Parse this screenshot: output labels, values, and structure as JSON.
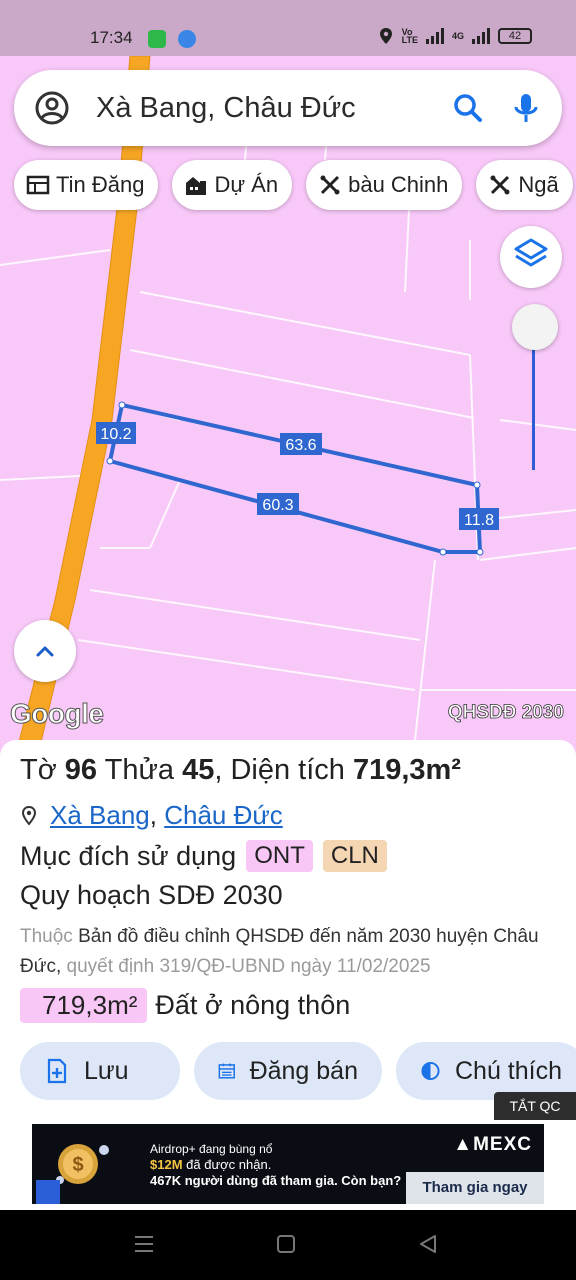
{
  "status_bar": {
    "time": "17:34",
    "network_label": "4G",
    "battery_level": "42"
  },
  "search": {
    "query": "Xà Bang, Châu Đức"
  },
  "chips": [
    {
      "label": "Tin Đăng",
      "icon": "listing-icon"
    },
    {
      "label": "Dự Án",
      "icon": "building-icon"
    },
    {
      "label": "bàu Chinh",
      "icon": "tools-icon"
    },
    {
      "label": "Ngã",
      "icon": "tools-icon"
    }
  ],
  "map": {
    "edge_labels": [
      "10.2",
      "63.6",
      "60.3",
      "11.8"
    ],
    "logo": "Google",
    "layer_label": "QHSDĐ 2030",
    "colors": {
      "land": "#f8c8f8",
      "road": "#f6a623",
      "parcel": "#2f66cf"
    }
  },
  "parcel": {
    "title_prefix": "Tờ",
    "sheet_no": "96",
    "title_mid": "Thửa",
    "parcel_no": "45",
    "title_area_label": ", Diện tích",
    "area": "719,3m²",
    "location_ward": "Xà Bang",
    "location_district": "Châu Đức",
    "purpose_label": "Mục đích sử dụng",
    "purpose_codes": [
      "ONT",
      "CLN"
    ],
    "plan_title": "Quy hoạch SDĐ 2030",
    "plan_source_prefix": "Thuộc",
    "plan_source": "Bản đồ điều chỉnh QHSDĐ đến năm 2030 huyện Châu Đức,",
    "plan_decision": "quyết định 319/QĐ-UBND ngày 11/02/2025",
    "land_area": "719,3m²",
    "land_type": "Đất ở nông thôn"
  },
  "actions": {
    "save": "Lưu",
    "post": "Đăng bán",
    "legend": "Chú thích"
  },
  "ad": {
    "close_label": "TẮT QC",
    "line1": "Airdrop+ đang bùng nổ",
    "line2_amount": "$12M",
    "line2_rest": " đã được nhận.",
    "line3": "467K người dùng đã tham gia. Còn bạn?",
    "brand": "MEXC",
    "cta": "Tham gia ngay"
  }
}
